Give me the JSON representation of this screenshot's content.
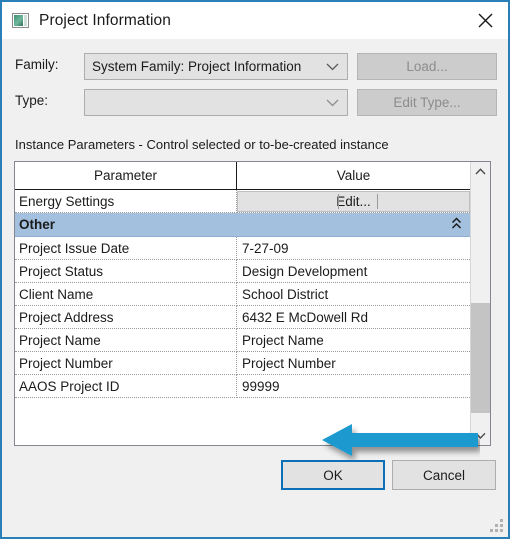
{
  "window": {
    "title": "Project Information",
    "icon": "project-information-icon",
    "close_icon": "close-icon",
    "border_color": "#2a7fb8"
  },
  "form": {
    "family": {
      "label": "Family:",
      "value": "System Family: Project Information",
      "arrow_icon": "chevron-down-icon",
      "button_label": "Load...",
      "button_disabled": true
    },
    "type": {
      "label": "Type:",
      "value": "",
      "arrow_icon": "chevron-down-icon",
      "button_label": "Edit Type...",
      "button_disabled": true
    }
  },
  "parameters_section": {
    "caption": "Instance Parameters - Control selected or to-be-created instance",
    "columns": [
      "Parameter",
      "Value"
    ],
    "energy_row": {
      "parameter": "Energy Settings",
      "button_label": "Edit..."
    },
    "group": {
      "label": "Other",
      "collapse_icon": "chevron-double-up-icon",
      "header_color": "#a3c0de"
    },
    "rows": [
      {
        "parameter": "Project Issue Date",
        "value": "7-27-09"
      },
      {
        "parameter": "Project Status",
        "value": "Design Development"
      },
      {
        "parameter": "Client Name",
        "value": "School District"
      },
      {
        "parameter": "Project Address",
        "value": "6432 E McDowell Rd"
      },
      {
        "parameter": "Project Name",
        "value": "Project Name"
      },
      {
        "parameter": "Project Number",
        "value": "Project Number"
      },
      {
        "parameter": "AAOS Project ID",
        "value": "99999"
      }
    ],
    "scrollbar": {
      "up_icon": "chevron-up-icon",
      "down_icon": "chevron-down-icon",
      "thumb_name": "scrollbar-thumb"
    }
  },
  "annotation": {
    "arrow_name": "annotation-arrow-left",
    "color": "#1f9ad0",
    "points_to": "AAOS Project ID value"
  },
  "footer": {
    "ok_label": "OK",
    "cancel_label": "Cancel",
    "ok_focus_color": "#0d6fb8"
  },
  "resize_grip": "resize-grip"
}
